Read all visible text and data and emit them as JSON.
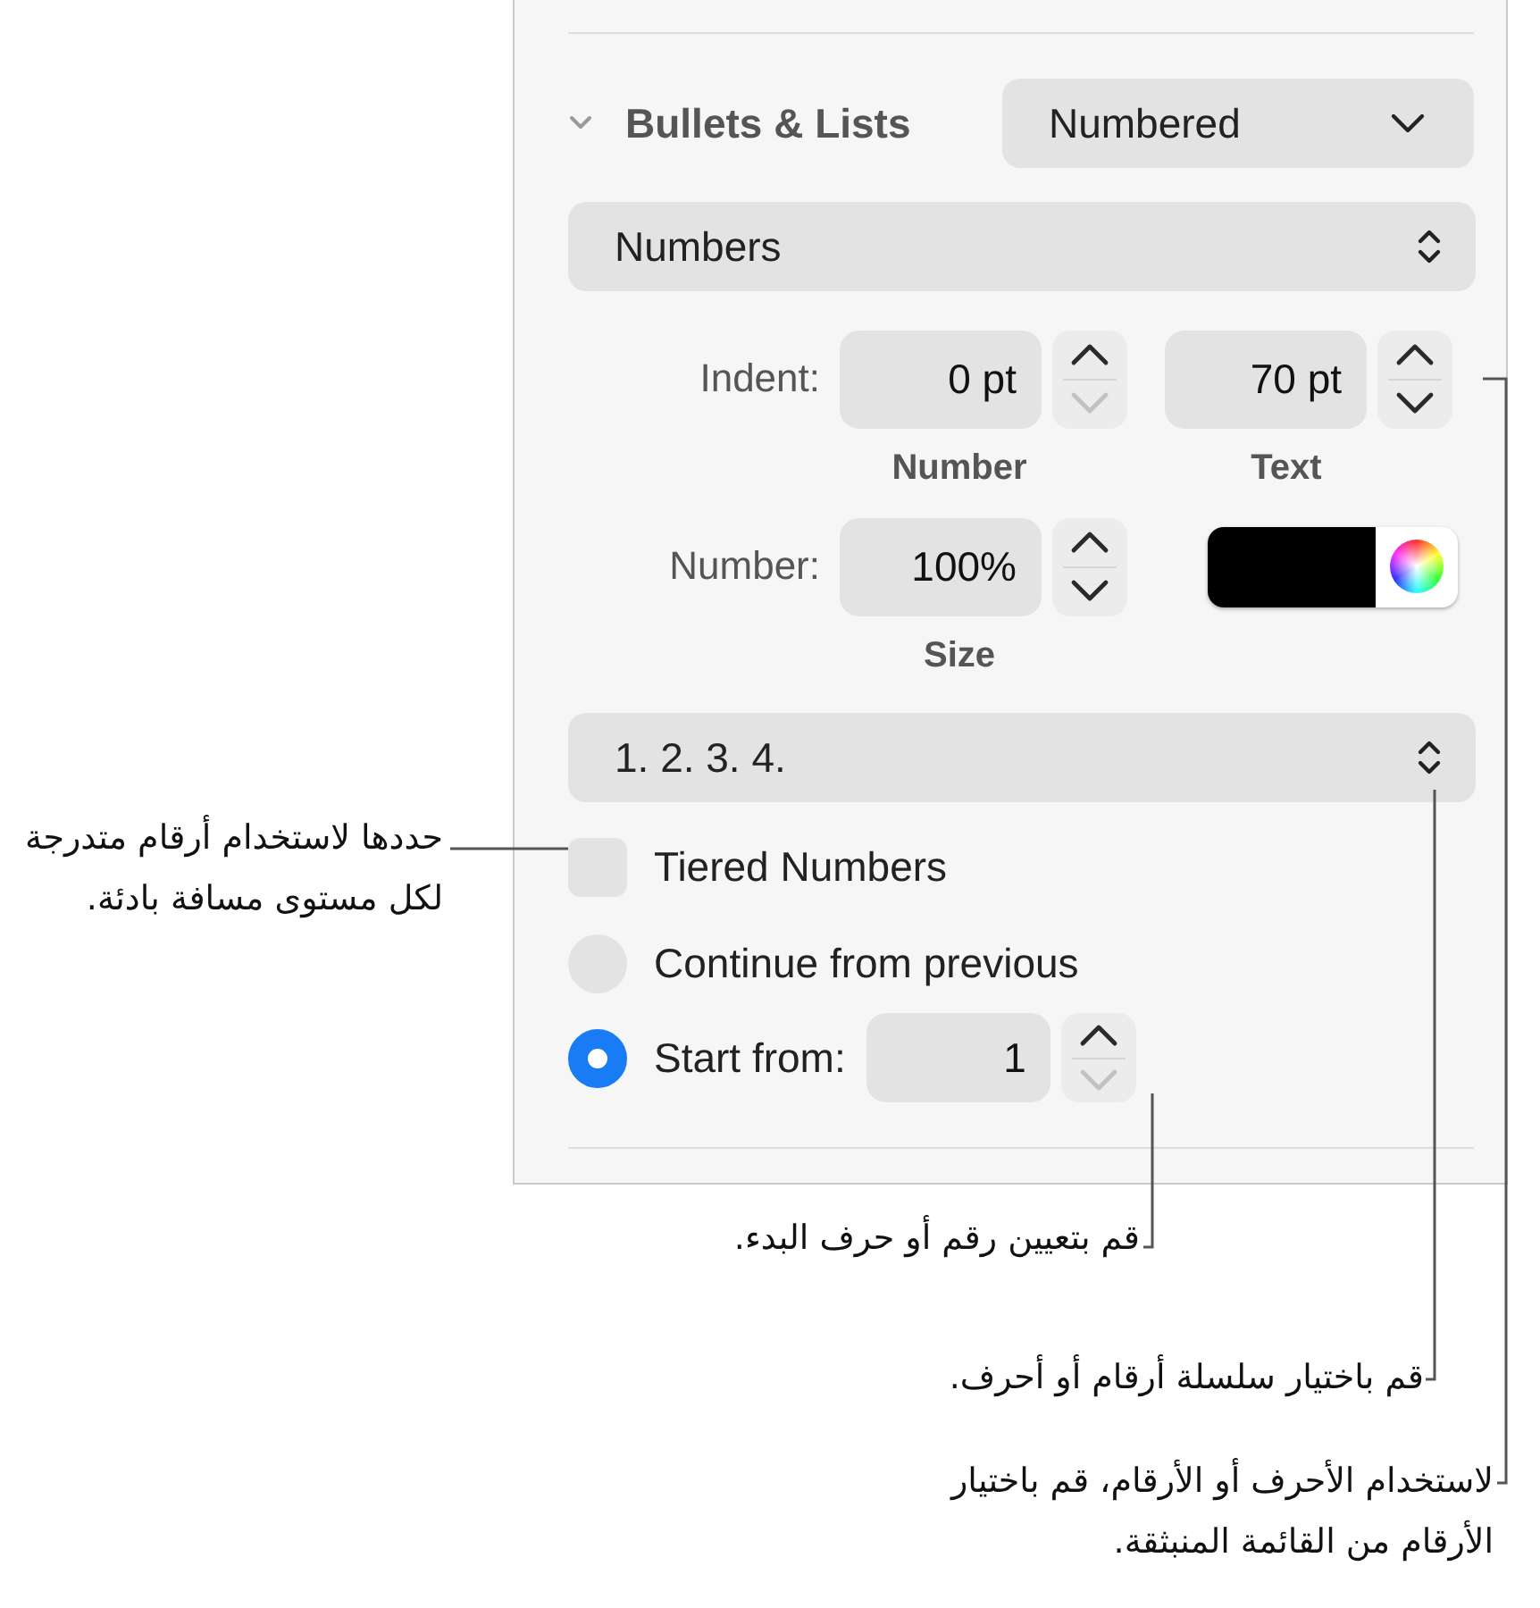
{
  "inspector": {
    "section": {
      "title": "Bullets & Lists",
      "expanded": true,
      "style_popup": "Numbered"
    },
    "list_type_popup": "Numbers",
    "indent": {
      "label": "Indent:",
      "number": {
        "value": "0 pt",
        "caption": "Number",
        "up_disabled": false,
        "down_disabled": true
      },
      "text": {
        "value": "70 pt",
        "caption": "Text",
        "up_disabled": false,
        "down_disabled": false
      }
    },
    "number_size": {
      "label": "Number:",
      "value": "100%",
      "caption": "Size",
      "up_disabled": false,
      "down_disabled": false,
      "color": "#000000"
    },
    "format_popup": "1. 2. 3. 4.",
    "tiered": {
      "label": "Tiered Numbers",
      "checked": false
    },
    "options": [
      {
        "label": "Continue from previous",
        "selected": false
      },
      {
        "label": "Start from:",
        "selected": true,
        "value": "1",
        "up_disabled": false,
        "down_disabled": true
      }
    ]
  },
  "callouts": [
    "حددها لاستخدام أرقام متدرجة لكل مستوى مسافة بادئة.",
    "قم بتعيين رقم أو حرف البدء.",
    "قم باختيار سلسلة أرقام أو أحرف.",
    "لاستخدام الأحرف أو الأرقام، قم باختيار الأرقام من القائمة المنبثقة."
  ]
}
